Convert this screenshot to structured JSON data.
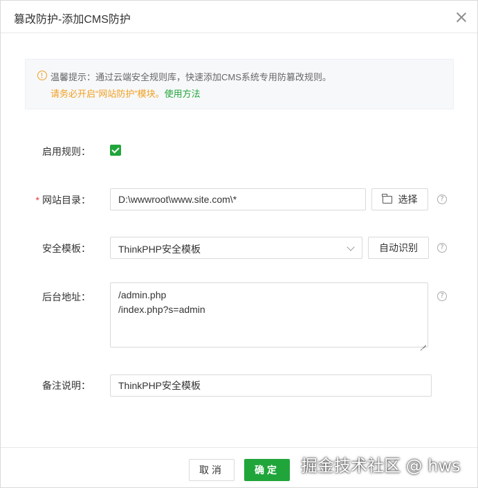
{
  "dialog": {
    "title": "篡改防护-添加CMS防护"
  },
  "tip": {
    "line1": "温馨提示：通过云端安全规则库，快速添加CMS系统专用防篡改规则。",
    "line2": "请务必开启“网站防护”模块。",
    "link": "使用方法"
  },
  "form": {
    "enable_label": "启用规则：",
    "enable_checked": true,
    "site_dir_label": "网站目录：",
    "site_dir_value": "D:\\wwwroot\\www.site.com\\*",
    "choose_button": "选择",
    "template_label": "安全模板：",
    "template_value": "ThinkPHP安全模板",
    "auto_detect_button": "自动识别",
    "backend_label": "后台地址：",
    "backend_lines": [
      "/admin.php",
      "/index.php?s=admin"
    ],
    "remark_label": "备注说明：",
    "remark_value": "ThinkPHP安全模板",
    "help_glyph": "?"
  },
  "footer": {
    "cancel": "取消",
    "ok": "确定"
  },
  "watermark": "掘金技术社区 @ hws",
  "colors": {
    "accent": "#20a53a",
    "warning": "#f0a020",
    "required": "#e4393c"
  }
}
